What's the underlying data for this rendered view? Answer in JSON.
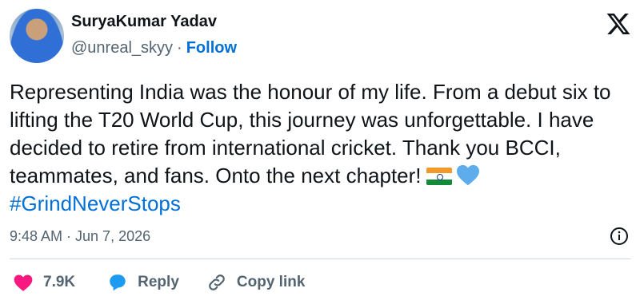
{
  "author": {
    "name": "SuryaKumar Yadav",
    "handle": "@unreal_skyy",
    "separator": "·",
    "follow_label": "Follow"
  },
  "tweet": {
    "text": "Representing India was the honour of my life. From a debut six to lifting the T20 World Cup, this journey was unforgettable. I have decided to retire from international cricket. Thank you BCCI, teammates, and fans. Onto the next chapter!",
    "emojis": [
      "india-flag",
      "blue-heart"
    ],
    "hashtag": "#GrindNeverStops"
  },
  "meta": {
    "timestamp": "9:48 AM · Jun 7, 2026"
  },
  "actions": {
    "likes": "7.9K",
    "reply_label": "Reply",
    "copy_label": "Copy link"
  },
  "colors": {
    "accent": "#006fd6",
    "heart": "#f91880",
    "muted": "#536471",
    "divider": "#cfd9de"
  }
}
